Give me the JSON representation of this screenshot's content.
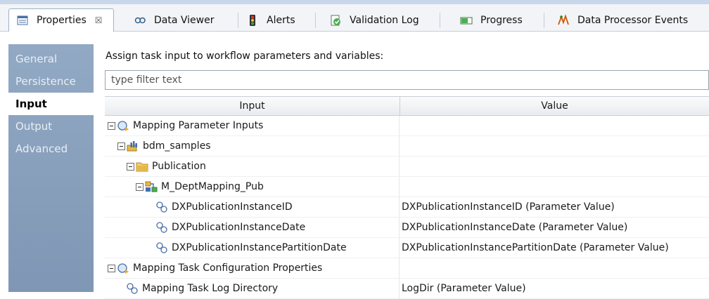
{
  "tabs": [
    {
      "label": "Properties",
      "icon": "properties-icon",
      "active": true,
      "close": "☒"
    },
    {
      "label": "Data Viewer",
      "icon": "data-viewer-icon"
    },
    {
      "label": "Alerts",
      "icon": "alerts-icon"
    },
    {
      "label": "Validation Log",
      "icon": "validation-log-icon"
    },
    {
      "label": "Progress",
      "icon": "progress-icon"
    },
    {
      "label": "Data Processor Events",
      "icon": "data-processor-events-icon"
    }
  ],
  "sidebar": {
    "items": [
      {
        "label": "General"
      },
      {
        "label": "Persistence"
      },
      {
        "label": "Input",
        "active": true
      },
      {
        "label": "Output"
      },
      {
        "label": "Advanced"
      }
    ]
  },
  "main": {
    "prompt": "Assign task input to workflow parameters and variables:",
    "filter_placeholder": "type filter text",
    "columns": {
      "input": "Input",
      "value": "Value"
    },
    "rows": [
      {
        "label": "Mapping Parameter Inputs",
        "value": "",
        "icon": "parameter-group-icon",
        "expanded": true
      },
      {
        "label": "bdm_samples",
        "value": "",
        "icon": "project-icon",
        "expanded": true
      },
      {
        "label": "Publication",
        "value": "",
        "icon": "folder-icon",
        "expanded": true
      },
      {
        "label": "M_DeptMapping_Pub",
        "value": "",
        "icon": "mapping-icon",
        "expanded": true
      },
      {
        "label": "DXPublicationInstanceID",
        "value": "DXPublicationInstanceID (Parameter Value)",
        "icon": "parameter-icon"
      },
      {
        "label": "DXPublicationInstanceDate",
        "value": "DXPublicationInstanceDate (Parameter Value)",
        "icon": "parameter-icon"
      },
      {
        "label": "DXPublicationInstancePartitionDate",
        "value": "DXPublicationInstancePartitionDate (Parameter Value)",
        "icon": "parameter-icon"
      },
      {
        "label": "Mapping Task Configuration Properties",
        "value": "",
        "icon": "parameter-group-icon",
        "expanded": true
      },
      {
        "label": "Mapping Task Log Directory",
        "value": "LogDir (Parameter Value)",
        "icon": "parameter-icon"
      }
    ]
  },
  "colors": {
    "sidebar": "#8aa1bd",
    "active_tab_border": "#9fb3cc",
    "folder": "#e6b84a"
  }
}
